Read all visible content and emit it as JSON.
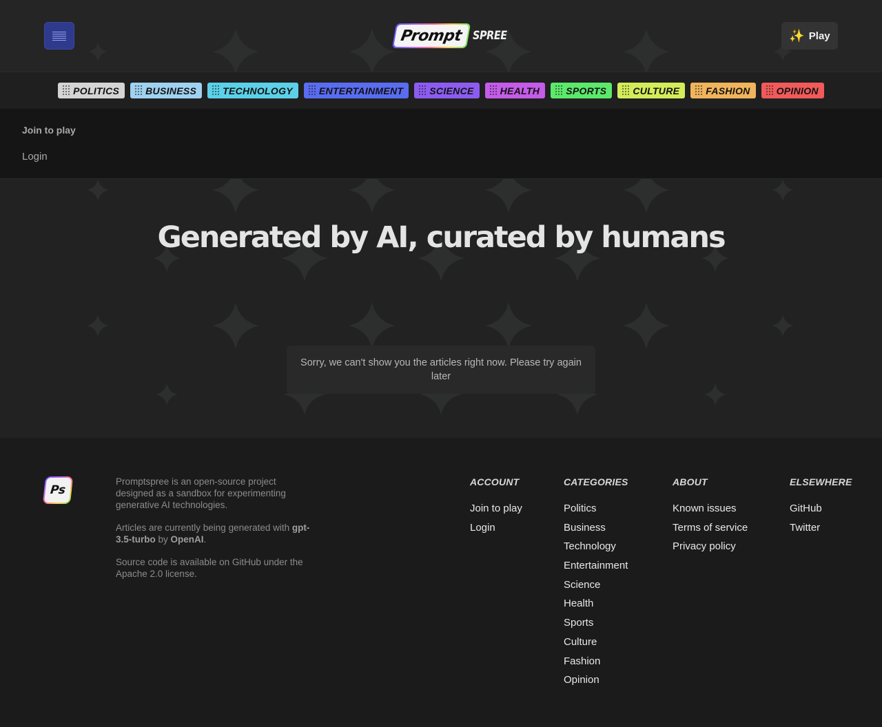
{
  "header": {
    "logo_word_1": "Prompt",
    "logo_word_2": "SPREE",
    "play_icon": "sparkles-icon",
    "play_label": "Play",
    "menu_icon": "hamburger-menu-icon"
  },
  "categories": [
    {
      "label": "POLITICS",
      "color": "#d4d4d4"
    },
    {
      "label": "BUSINESS",
      "color": "#9fd1f0"
    },
    {
      "label": "TECHNOLOGY",
      "color": "#5cd0e8"
    },
    {
      "label": "ENTERTAINMENT",
      "color": "#5a6cf0"
    },
    {
      "label": "SCIENCE",
      "color": "#8c5cf0"
    },
    {
      "label": "HEALTH",
      "color": "#c45ce8"
    },
    {
      "label": "SPORTS",
      "color": "#5ce86a"
    },
    {
      "label": "CULTURE",
      "color": "#d4ec5a"
    },
    {
      "label": "FASHION",
      "color": "#f0b45c"
    },
    {
      "label": "OPINION",
      "color": "#f05a5a"
    }
  ],
  "menu": {
    "join_label": "Join to play",
    "login_label": "Login"
  },
  "hero": {
    "headline": "Generated by AI, curated by humans",
    "error_message": "Sorry, we can't show you the articles right now. Please try again later"
  },
  "footer": {
    "logo_text": "Ps",
    "about_p1": "Promptspree is an open-source project designed as a sandbox for experimenting generative AI technologies.",
    "about_p2_prefix": "Articles are currently being generated with ",
    "about_p2_model": "gpt-3.5-turbo",
    "about_p2_by": " by ",
    "about_p2_org": "OpenAI",
    "about_p2_suffix": ".",
    "about_p3": "Source code is available on GitHub under the Apache 2.0 license.",
    "columns": [
      {
        "title": "ACCOUNT",
        "links": [
          "Join to play",
          "Login"
        ]
      },
      {
        "title": "CATEGORIES",
        "links": [
          "Politics",
          "Business",
          "Technology",
          "Entertainment",
          "Science",
          "Health",
          "Sports",
          "Culture",
          "Fashion",
          "Opinion"
        ]
      },
      {
        "title": "ABOUT",
        "links": [
          "Known issues",
          "Terms of service",
          "Privacy policy"
        ]
      },
      {
        "title": "ELSEWHERE",
        "links": [
          "GitHub",
          "Twitter"
        ]
      }
    ]
  },
  "colors": {
    "menu_button": "#2e3a8c",
    "background": "#1b1b1b",
    "hero_background": "#222222",
    "star_pattern": "#2c2f2e"
  }
}
